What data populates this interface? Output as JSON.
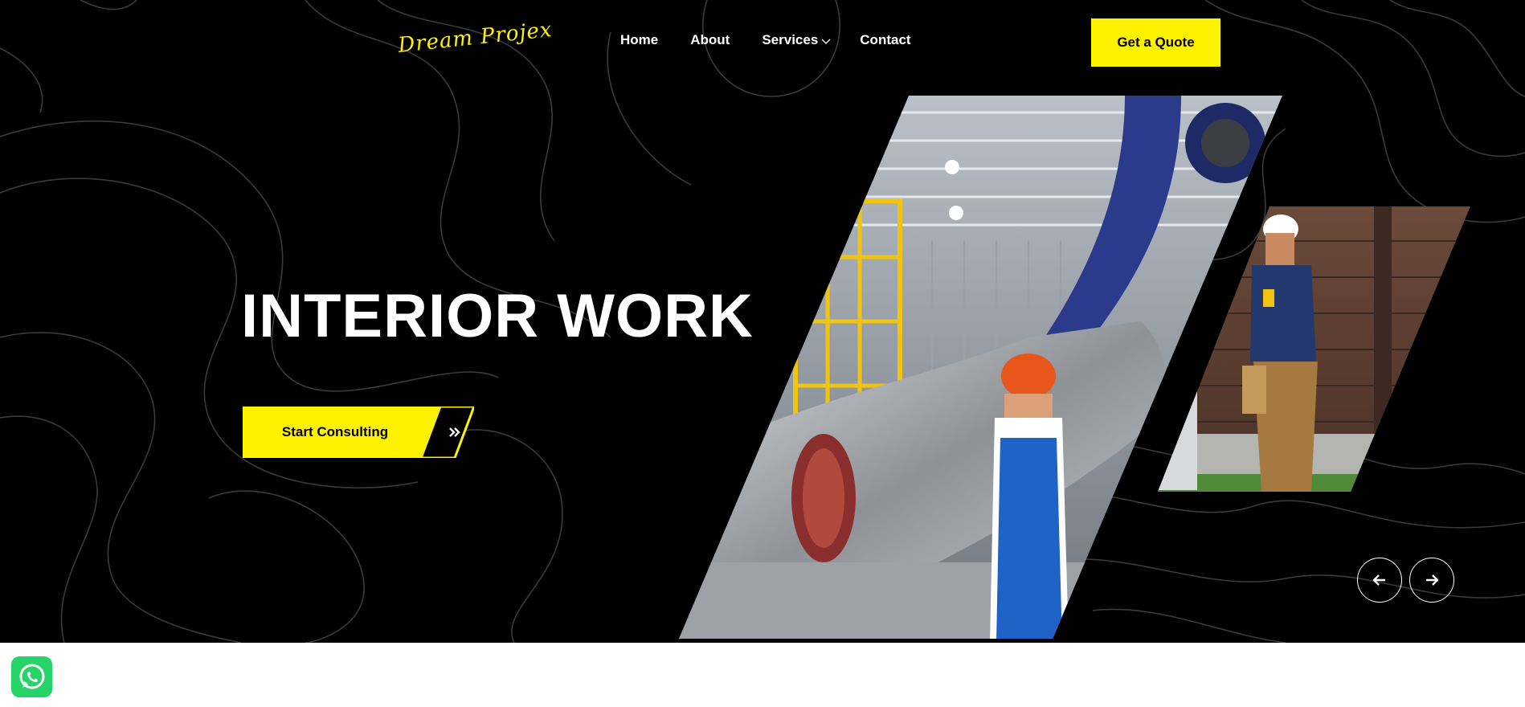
{
  "header": {
    "logo_text": "Dream Projex",
    "nav": [
      {
        "label": "Home"
      },
      {
        "label": "About"
      },
      {
        "label": "Services",
        "has_dropdown": true
      },
      {
        "label": "Contact"
      }
    ],
    "quote_label": "Get a Quote"
  },
  "hero": {
    "title": "INTERIOR WORK",
    "cta_label": "Start Consulting",
    "cta_icon": "double-chevron-right-icon"
  },
  "slider": {
    "prev_icon": "arrow-left-icon",
    "next_icon": "arrow-right-icon"
  },
  "widgets": {
    "chat_icon": "whatsapp-icon"
  },
  "colors": {
    "background": "#000000",
    "accent": "#fff200",
    "text": "#ffffff",
    "whatsapp": "#25d366"
  }
}
